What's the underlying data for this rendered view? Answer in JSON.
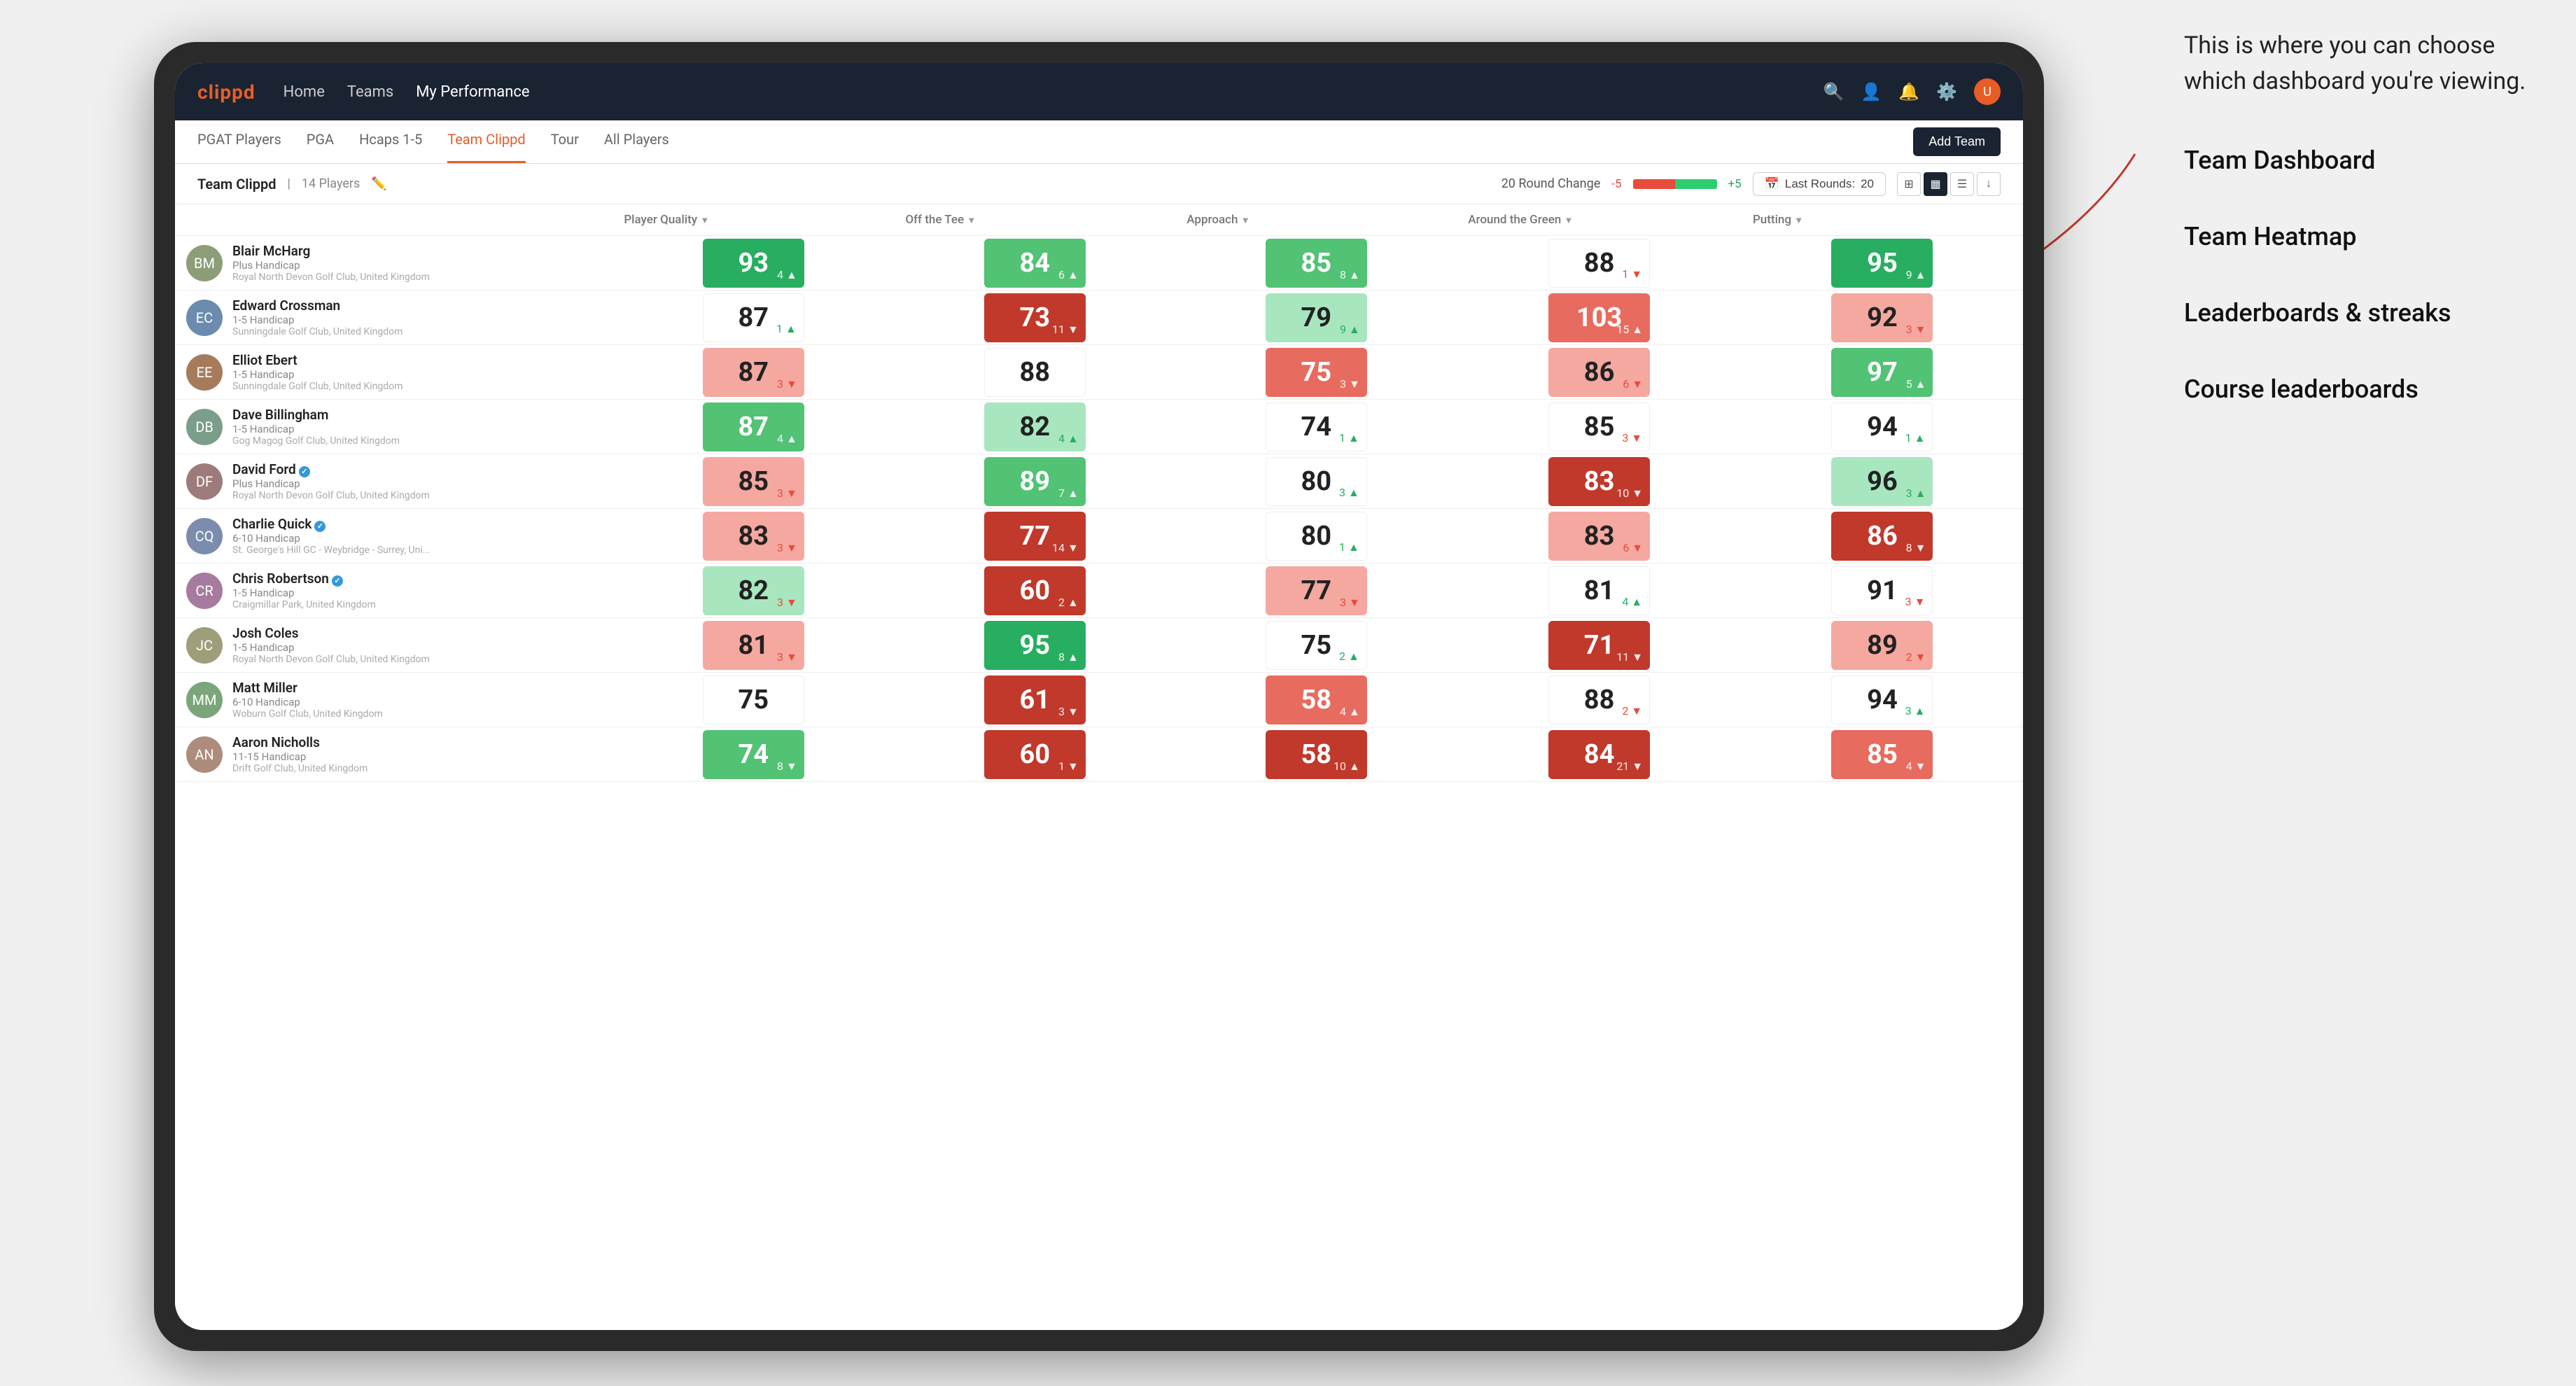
{
  "annotation": {
    "intro": "This is where you can choose which dashboard you're viewing.",
    "items": [
      "Team Dashboard",
      "Team Heatmap",
      "Leaderboards & streaks",
      "Course leaderboards"
    ]
  },
  "navbar": {
    "logo": "clippd",
    "links": [
      "Home",
      "Teams",
      "My Performance"
    ],
    "active_link": "My Performance"
  },
  "subtabs": {
    "tabs": [
      "PGAT Players",
      "PGA",
      "Hcaps 1-5",
      "Team Clippd",
      "Tour",
      "All Players"
    ],
    "active": "Team Clippd",
    "add_team_label": "Add Team"
  },
  "team_bar": {
    "name": "Team Clippd",
    "separator": "|",
    "count": "14 Players",
    "round_change_label": "20 Round Change",
    "neg": "-5",
    "pos": "+5",
    "last_rounds_label": "Last Rounds:",
    "last_rounds_value": "20"
  },
  "table": {
    "columns": [
      "Player Quality ↓",
      "Off the Tee ↓",
      "Approach ↓",
      "Around the Green ↓",
      "Putting ↓"
    ],
    "rows": [
      {
        "name": "Blair McHarg",
        "handicap": "Plus Handicap",
        "club": "Royal North Devon Golf Club, United Kingdom",
        "avatar_initials": "BM",
        "pq": 93,
        "pq_change": "+4",
        "pq_dir": "up",
        "pq_bg": "bg-green-strong",
        "tee": 84,
        "tee_change": "+6",
        "tee_dir": "up",
        "tee_bg": "bg-green-medium",
        "approach": 85,
        "approach_change": "+8",
        "approach_dir": "up",
        "approach_bg": "bg-green-medium",
        "around": 88,
        "around_change": "-1",
        "around_dir": "down",
        "around_bg": "bg-white",
        "putting": 95,
        "putting_change": "+9",
        "putting_dir": "up",
        "putting_bg": "bg-green-strong"
      },
      {
        "name": "Edward Crossman",
        "handicap": "1-5 Handicap",
        "club": "Sunningdale Golf Club, United Kingdom",
        "avatar_initials": "EC",
        "pq": 87,
        "pq_change": "+1",
        "pq_dir": "up",
        "pq_bg": "bg-white",
        "tee": 73,
        "tee_change": "-11",
        "tee_dir": "down",
        "tee_bg": "bg-red-strong",
        "approach": 79,
        "approach_change": "+9",
        "approach_dir": "up",
        "approach_bg": "bg-green-light",
        "around": 103,
        "around_change": "+15",
        "around_dir": "up",
        "around_bg": "bg-red-medium",
        "putting": 92,
        "putting_change": "-3",
        "putting_dir": "down",
        "putting_bg": "bg-red-light"
      },
      {
        "name": "Elliot Ebert",
        "handicap": "1-5 Handicap",
        "club": "Sunningdale Golf Club, United Kingdom",
        "avatar_initials": "EE",
        "pq": 87,
        "pq_change": "-3",
        "pq_dir": "down",
        "pq_bg": "bg-red-light",
        "tee": 88,
        "tee_change": "",
        "tee_dir": "neutral",
        "tee_bg": "bg-white",
        "approach": 75,
        "approach_change": "-3",
        "approach_dir": "down",
        "approach_bg": "bg-red-medium",
        "around": 86,
        "around_change": "-6",
        "around_dir": "down",
        "around_bg": "bg-red-light",
        "putting": 97,
        "putting_change": "+5",
        "putting_dir": "up",
        "putting_bg": "bg-green-medium"
      },
      {
        "name": "Dave Billingham",
        "handicap": "1-5 Handicap",
        "club": "Gog Magog Golf Club, United Kingdom",
        "avatar_initials": "DB",
        "pq": 87,
        "pq_change": "+4",
        "pq_dir": "up",
        "pq_bg": "bg-green-medium",
        "tee": 82,
        "tee_change": "+4",
        "tee_dir": "up",
        "tee_bg": "bg-green-light",
        "approach": 74,
        "approach_change": "+1",
        "approach_dir": "up",
        "approach_bg": "bg-white",
        "around": 85,
        "around_change": "-3",
        "around_dir": "down",
        "around_bg": "bg-white",
        "putting": 94,
        "putting_change": "+1",
        "putting_dir": "up",
        "putting_bg": "bg-white"
      },
      {
        "name": "David Ford",
        "handicap": "Plus Handicap",
        "club": "Royal North Devon Golf Club, United Kingdom",
        "avatar_initials": "DF",
        "verified": true,
        "pq": 85,
        "pq_change": "-3",
        "pq_dir": "down",
        "pq_bg": "bg-red-light",
        "tee": 89,
        "tee_change": "+7",
        "tee_dir": "up",
        "tee_bg": "bg-green-medium",
        "approach": 80,
        "approach_change": "+3",
        "approach_dir": "up",
        "approach_bg": "bg-white",
        "around": 83,
        "around_change": "-10",
        "around_dir": "down",
        "around_bg": "bg-red-strong",
        "putting": 96,
        "putting_change": "+3",
        "putting_dir": "up",
        "putting_bg": "bg-green-light"
      },
      {
        "name": "Charlie Quick",
        "handicap": "6-10 Handicap",
        "club": "St. George's Hill GC - Weybridge - Surrey, Uni...",
        "avatar_initials": "CQ",
        "verified": true,
        "pq": 83,
        "pq_change": "-3",
        "pq_dir": "down",
        "pq_bg": "bg-red-light",
        "tee": 77,
        "tee_change": "-14",
        "tee_dir": "down",
        "tee_bg": "bg-red-strong",
        "approach": 80,
        "approach_change": "+1",
        "approach_dir": "up",
        "approach_bg": "bg-white",
        "around": 83,
        "around_change": "-6",
        "around_dir": "down",
        "around_bg": "bg-red-light",
        "putting": 86,
        "putting_change": "-8",
        "putting_dir": "down",
        "putting_bg": "bg-red-strong"
      },
      {
        "name": "Chris Robertson",
        "handicap": "1-5 Handicap",
        "club": "Craigmillar Park, United Kingdom",
        "avatar_initials": "CR",
        "verified": true,
        "pq": 82,
        "pq_change": "-3",
        "pq_dir": "down",
        "pq_bg": "bg-green-light",
        "tee": 60,
        "tee_change": "+2",
        "tee_dir": "up",
        "tee_bg": "bg-red-strong",
        "approach": 77,
        "approach_change": "-3",
        "approach_dir": "down",
        "approach_bg": "bg-red-light",
        "around": 81,
        "around_change": "+4",
        "around_dir": "up",
        "around_bg": "bg-white",
        "putting": 91,
        "putting_change": "-3",
        "putting_dir": "down",
        "putting_bg": "bg-white"
      },
      {
        "name": "Josh Coles",
        "handicap": "1-5 Handicap",
        "club": "Royal North Devon Golf Club, United Kingdom",
        "avatar_initials": "JC",
        "pq": 81,
        "pq_change": "-3",
        "pq_dir": "down",
        "pq_bg": "bg-red-light",
        "tee": 95,
        "tee_change": "+8",
        "tee_dir": "up",
        "tee_bg": "bg-green-strong",
        "approach": 75,
        "approach_change": "+2",
        "approach_dir": "up",
        "approach_bg": "bg-white",
        "around": 71,
        "around_change": "-11",
        "around_dir": "down",
        "around_bg": "bg-red-strong",
        "putting": 89,
        "putting_change": "-2",
        "putting_dir": "down",
        "putting_bg": "bg-red-light"
      },
      {
        "name": "Matt Miller",
        "handicap": "6-10 Handicap",
        "club": "Woburn Golf Club, United Kingdom",
        "avatar_initials": "MM",
        "pq": 75,
        "pq_change": "",
        "pq_dir": "neutral",
        "pq_bg": "bg-white",
        "tee": 61,
        "tee_change": "-3",
        "tee_dir": "down",
        "tee_bg": "bg-red-strong",
        "approach": 58,
        "approach_change": "+4",
        "approach_dir": "up",
        "approach_bg": "bg-red-medium",
        "around": 88,
        "around_change": "-2",
        "around_dir": "down",
        "around_bg": "bg-white",
        "putting": 94,
        "putting_change": "+3",
        "putting_dir": "up",
        "putting_bg": "bg-white"
      },
      {
        "name": "Aaron Nicholls",
        "handicap": "11-15 Handicap",
        "club": "Drift Golf Club, United Kingdom",
        "avatar_initials": "AN",
        "pq": 74,
        "pq_change": "-8",
        "pq_dir": "down",
        "pq_bg": "bg-green-medium",
        "tee": 60,
        "tee_change": "-1",
        "tee_dir": "down",
        "tee_bg": "bg-red-strong",
        "approach": 58,
        "approach_change": "+10",
        "approach_dir": "up",
        "approach_bg": "bg-red-strong",
        "around": 84,
        "around_change": "-21",
        "around_dir": "down",
        "around_bg": "bg-red-strong",
        "putting": 85,
        "putting_change": "-4",
        "putting_dir": "down",
        "putting_bg": "bg-red-medium"
      }
    ]
  }
}
